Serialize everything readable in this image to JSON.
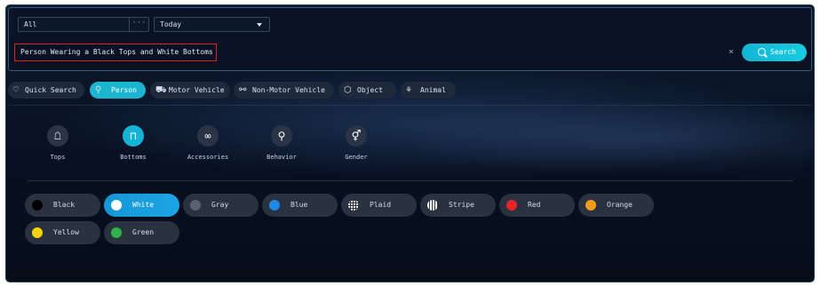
{
  "filters": {
    "scope_value": "All",
    "scope_more": "···",
    "time_value": "Today"
  },
  "query": {
    "text": "Person Wearing a Black Tops and White Bottoms",
    "clear_symbol": "×",
    "search_label": "Search"
  },
  "tabs": [
    {
      "label": "Quick Search",
      "icon": "heart-icon",
      "active": false
    },
    {
      "label": "Person",
      "icon": "person-icon",
      "active": true
    },
    {
      "label": "Motor Vehicle",
      "icon": "car-icon",
      "active": false
    },
    {
      "label": "Non-Motor Vehicle",
      "icon": "bicycle-icon",
      "active": false
    },
    {
      "label": "Object",
      "icon": "cube-icon",
      "active": false
    },
    {
      "label": "Animal",
      "icon": "animal-icon",
      "active": false
    }
  ],
  "categories": [
    {
      "label": "Tops",
      "icon": "shirt-icon",
      "active": false
    },
    {
      "label": "Bottoms",
      "icon": "pants-icon",
      "active": true
    },
    {
      "label": "Accessories",
      "icon": "glasses-icon",
      "active": false
    },
    {
      "label": "Behavior",
      "icon": "walking-icon",
      "active": false
    },
    {
      "label": "Gender",
      "icon": "gender-icon",
      "active": false
    }
  ],
  "colors": [
    {
      "label": "Black",
      "swatch": "#000000",
      "active": false
    },
    {
      "label": "White",
      "swatch": "#ffffff",
      "active": true
    },
    {
      "label": "Gray",
      "swatch": "#5a6270",
      "active": false
    },
    {
      "label": "Blue",
      "swatch": "#1e88e5",
      "active": false
    },
    {
      "label": "Plaid",
      "swatch": "plaid-pattern",
      "active": false
    },
    {
      "label": "Stripe",
      "swatch": "stripe-pattern",
      "active": false
    },
    {
      "label": "Red",
      "swatch": "#e5232b",
      "active": false
    },
    {
      "label": "Orange",
      "swatch": "#f39a16",
      "active": false
    },
    {
      "label": "Yellow",
      "swatch": "#f6d20a",
      "active": false
    },
    {
      "label": "Green",
      "swatch": "#2fb24a",
      "active": false
    }
  ],
  "theme": {
    "accent": "#1bb5cf",
    "highlight_border": "#e0202a",
    "panel_bg": "#0a1527"
  }
}
